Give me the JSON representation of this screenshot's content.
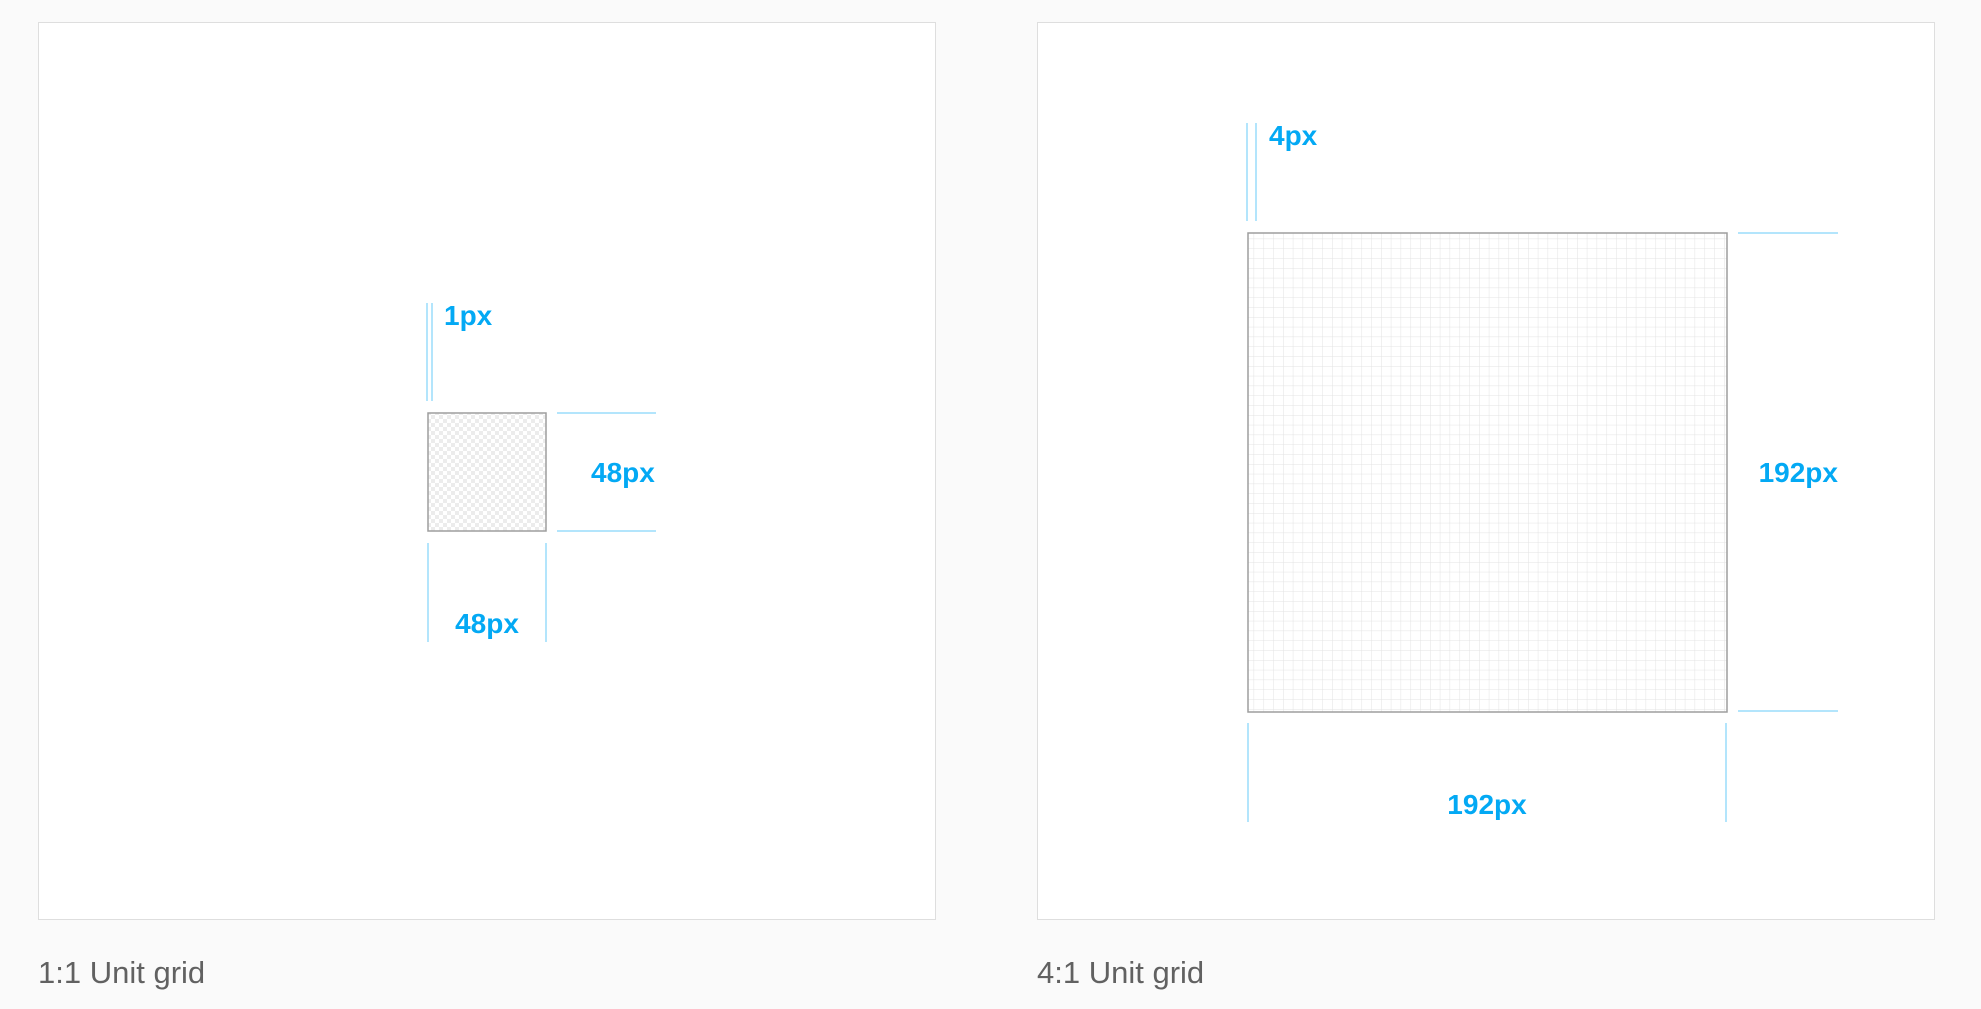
{
  "colors": {
    "accent": "#03a9f4",
    "guide": "#b3e5fc",
    "outline": "#9e9e9e",
    "grid": "#e3e3e3"
  },
  "panels": [
    {
      "caption": "1:1 Unit grid",
      "unit_label": "1px",
      "width_label": "48px",
      "height_label": "48px"
    },
    {
      "caption": "4:1 Unit grid",
      "unit_label": "4px",
      "width_label": "192px",
      "height_label": "192px"
    }
  ]
}
